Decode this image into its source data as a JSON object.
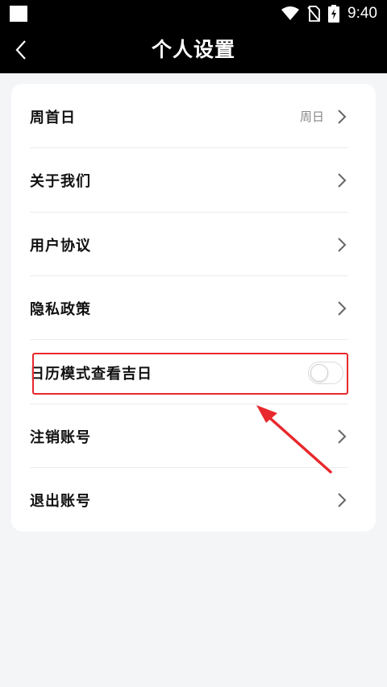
{
  "status_bar": {
    "time": "9:40",
    "icons": [
      "wifi-icon",
      "no-sim-icon",
      "battery-charging-icon"
    ]
  },
  "header": {
    "back_icon": "chevron-left-icon",
    "title": "个人设置"
  },
  "settings": {
    "first_day": {
      "label": "周首日",
      "value": "周日"
    },
    "about": {
      "label": "关于我们"
    },
    "user_agreement": {
      "label": "用户协议"
    },
    "privacy_policy": {
      "label": "隐私政策"
    },
    "lucky_day_toggle": {
      "label": "日历模式查看吉日",
      "enabled": false
    },
    "cancel_account": {
      "label": "注销账号"
    },
    "logout": {
      "label": "退出账号"
    }
  },
  "annotation": {
    "highlight_color": "#e8282c"
  },
  "colors": {
    "header_bg": "#000000",
    "page_bg": "#f4f5f7",
    "card_bg": "#ffffff"
  }
}
